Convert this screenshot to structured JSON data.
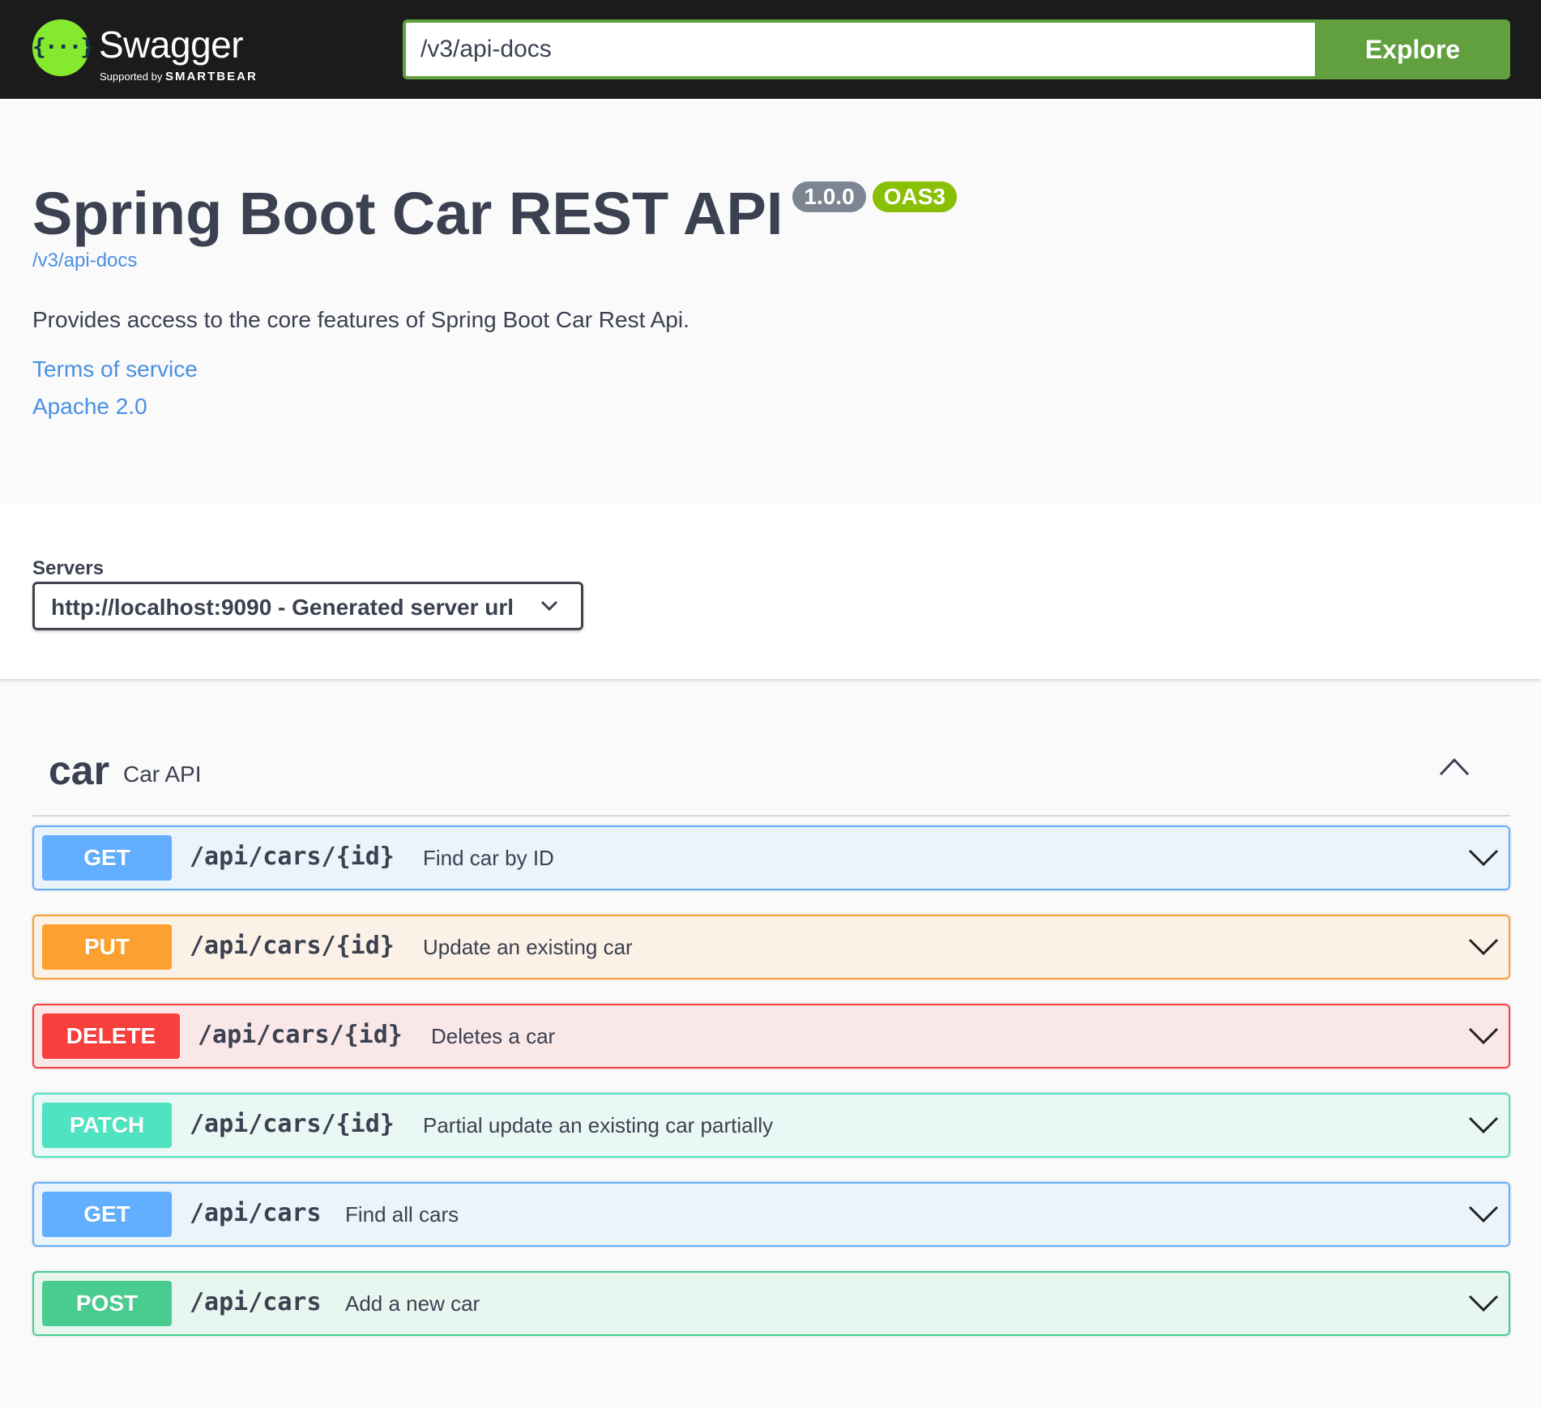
{
  "topbar": {
    "logo_word": "Swagger",
    "logo_sub_prefix": "Supported by",
    "logo_sub_brand": "SMARTBEAR",
    "url_value": "/v3/api-docs",
    "explore_label": "Explore"
  },
  "info": {
    "title": "Spring Boot Car REST API",
    "version_badge": "1.0.0",
    "oas_badge": "OAS3",
    "spec_link": "/v3/api-docs",
    "description": "Provides access to the core features of Spring Boot Car Rest Api.",
    "terms_link": "Terms of service",
    "license_link": "Apache 2.0"
  },
  "servers": {
    "label": "Servers",
    "selected": "http://localhost:9090 - Generated server url"
  },
  "tag": {
    "name": "car",
    "description": "Car API"
  },
  "operations": [
    {
      "method": "GET",
      "path": "/api/cars/{id}",
      "summary": "Find car by ID"
    },
    {
      "method": "PUT",
      "path": "/api/cars/{id}",
      "summary": "Update an existing car"
    },
    {
      "method": "DELETE",
      "path": "/api/cars/{id}",
      "summary": "Deletes a car"
    },
    {
      "method": "PATCH",
      "path": "/api/cars/{id}",
      "summary": "Partial update an existing car partially"
    },
    {
      "method": "GET",
      "path": "/api/cars",
      "summary": "Find all cars"
    },
    {
      "method": "POST",
      "path": "/api/cars",
      "summary": "Add a new car"
    }
  ],
  "colors": {
    "get": "#61affe",
    "put": "#fca130",
    "delete": "#f93e3e",
    "patch": "#50e3c2",
    "post": "#49cc90",
    "explore": "#62a03f",
    "logo": "#85ea2d"
  },
  "icons": {
    "logo": "swagger-braces-icon",
    "server_dropdown": "chevron-down-icon",
    "tag_toggle": "chevron-up-icon",
    "operation_expand": "chevron-down-icon"
  }
}
